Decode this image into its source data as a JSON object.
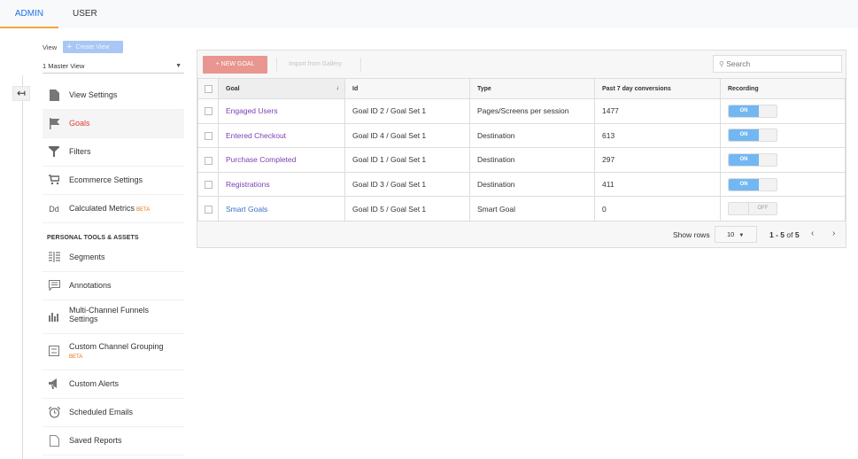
{
  "tabs": [
    {
      "label": "ADMIN",
      "active": true
    },
    {
      "label": "USER",
      "active": false
    }
  ],
  "view": {
    "label": "View",
    "create_button": "Create View",
    "selected": "1 Master View"
  },
  "nav": {
    "back_icon": "back-arrow-icon",
    "items": [
      {
        "label": "View Settings",
        "icon": "document-icon",
        "active": false
      },
      {
        "label": "Goals",
        "icon": "flag-icon",
        "active": true
      },
      {
        "label": "Filters",
        "icon": "filter-icon",
        "active": false
      },
      {
        "label": "Ecommerce Settings",
        "icon": "cart-icon",
        "active": false
      },
      {
        "label": "Calculated Metrics",
        "icon": "dd-icon",
        "badge": "BETA",
        "active": false
      }
    ],
    "section_title": "PERSONAL TOOLS & ASSETS",
    "personal_items": [
      {
        "label": "Segments",
        "icon": "segments-icon"
      },
      {
        "label": "Annotations",
        "icon": "comment-icon"
      },
      {
        "label": "Multi-Channel Funnels",
        "label2": "Settings",
        "icon": "bar-chart-icon"
      },
      {
        "label": "Custom Channel Grouping",
        "badge": "BETA",
        "icon": "grouping-icon"
      },
      {
        "label": "Custom Alerts",
        "icon": "megaphone-icon"
      },
      {
        "label": "Scheduled Emails",
        "icon": "alarm-clock-icon"
      },
      {
        "label": "Saved Reports",
        "icon": "report-icon"
      }
    ]
  },
  "toolbar": {
    "new_goal": "+ NEW GOAL",
    "import": "Import from Gallery",
    "search_placeholder": "Search"
  },
  "table": {
    "headers": [
      "Goal",
      "Id",
      "Type",
      "Past 7 day conversions",
      "Recording"
    ],
    "sort_indicator": "↓",
    "rows": [
      {
        "goal": "Engaged Users",
        "id": "Goal ID 2 / Goal Set 1",
        "type": "Pages/Screens per session",
        "conversions": "1477",
        "recording": "ON"
      },
      {
        "goal": "Entered Checkout",
        "id": "Goal ID 4 / Goal Set 1",
        "type": "Destination",
        "conversions": "613",
        "recording": "ON"
      },
      {
        "goal": "Purchase Completed",
        "id": "Goal ID 1 / Goal Set 1",
        "type": "Destination",
        "conversions": "297",
        "recording": "ON"
      },
      {
        "goal": "Registrations",
        "id": "Goal ID 3 / Goal Set 1",
        "type": "Destination",
        "conversions": "411",
        "recording": "ON"
      },
      {
        "goal": "Smart Goals",
        "id": "Goal ID 5 / Goal Set 1",
        "type": "Smart Goal",
        "conversions": "0",
        "recording": "OFF"
      }
    ]
  },
  "pagination": {
    "show_rows_label": "Show rows",
    "rows_value": "10",
    "range": "1 - 5",
    "of": "of",
    "total": "5",
    "prev": "‹",
    "next": "›"
  },
  "colors": {
    "accent_blue": "#1a73e8",
    "tab_underline": "#f4a73b",
    "active_nav": "#db4437",
    "new_goal_button": "#e8968f",
    "toggle_on": "#72b7f2",
    "visited_link": "#7b3fb5",
    "link": "#3a6fc4"
  }
}
